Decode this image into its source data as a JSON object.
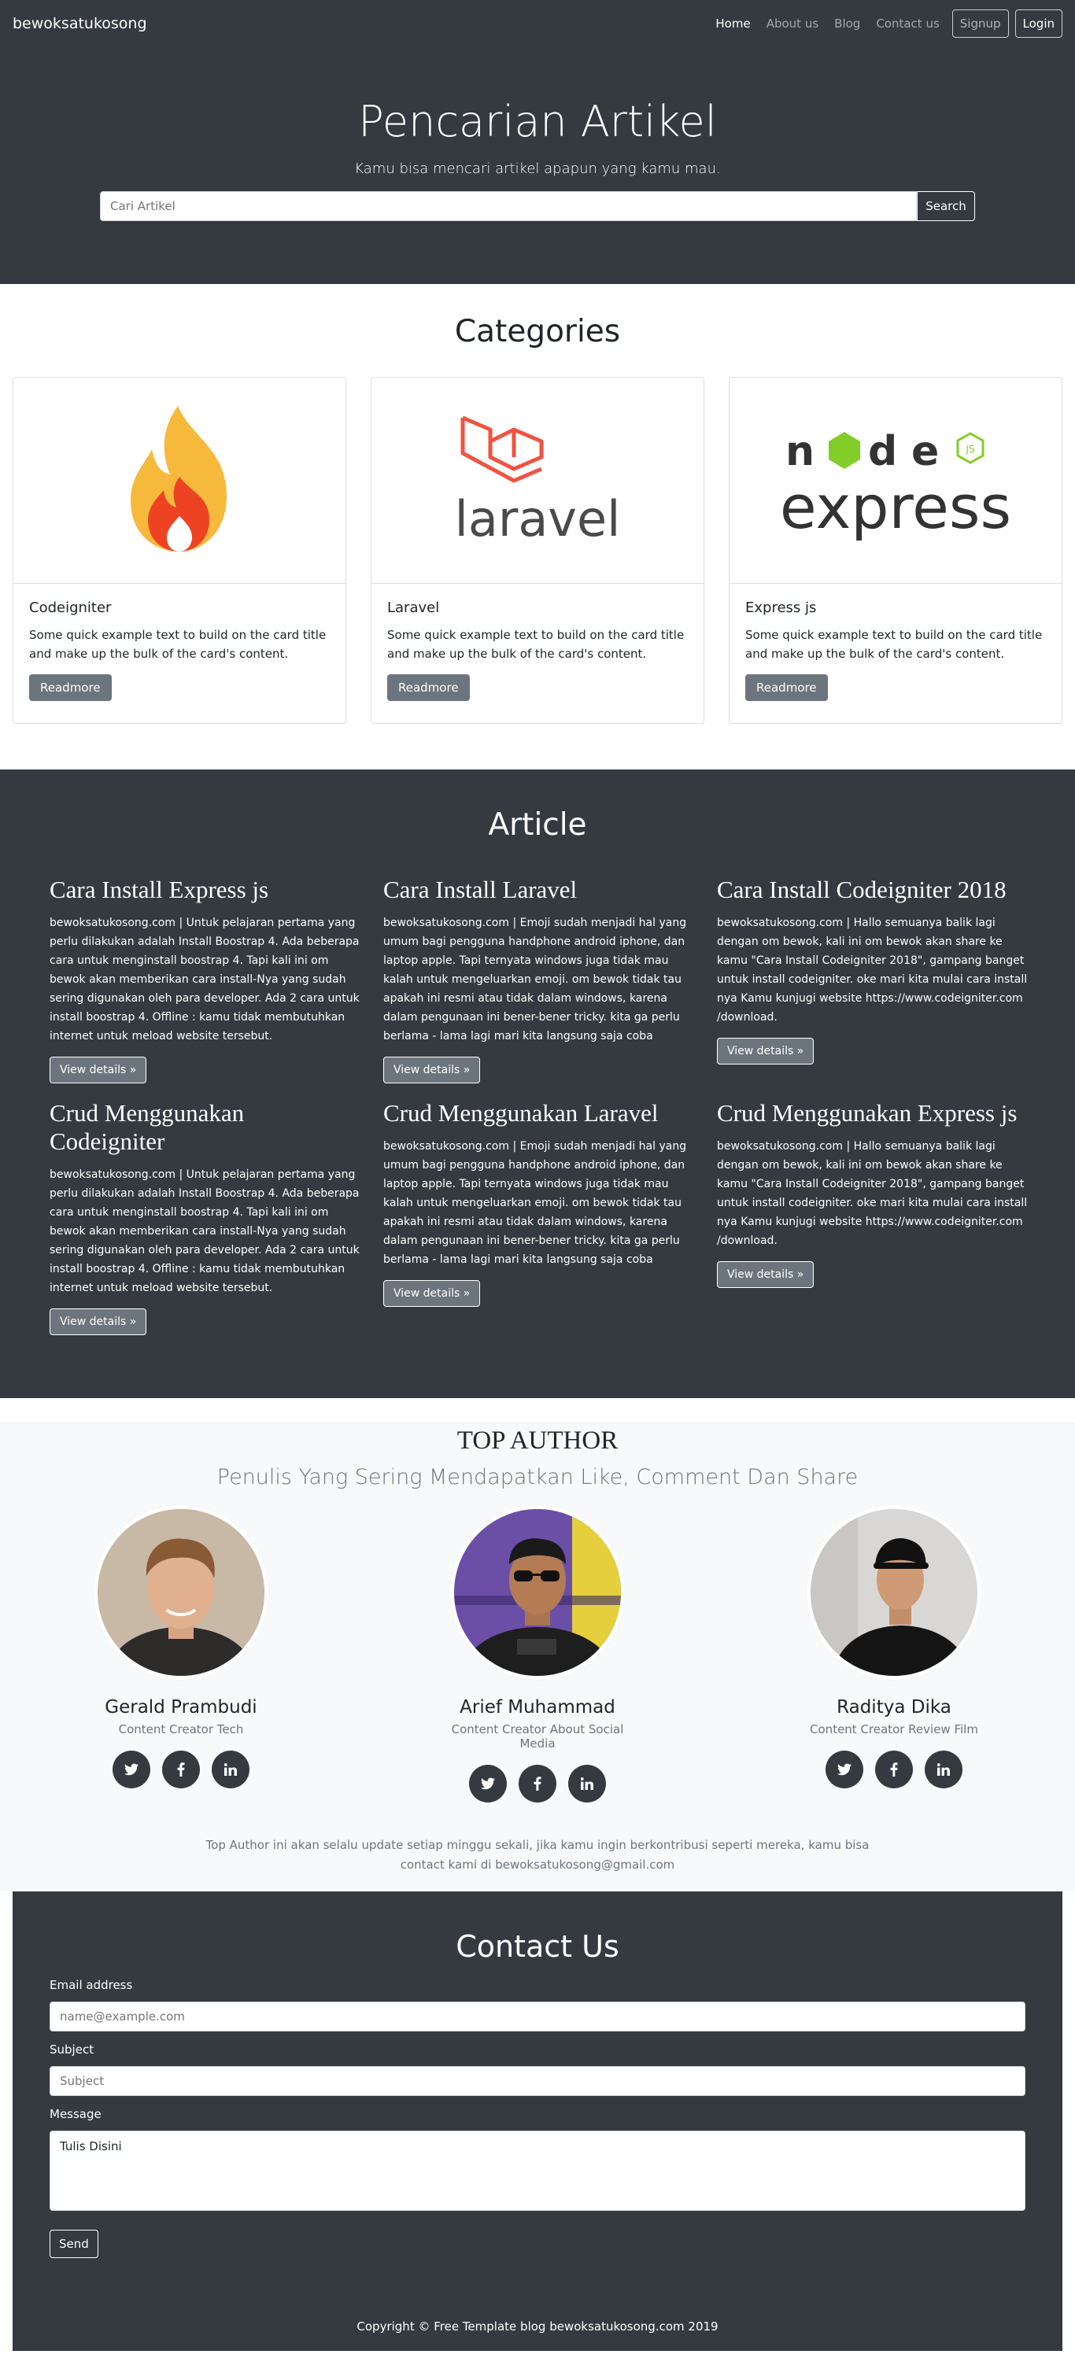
{
  "nav": {
    "brand": "bewoksatukosong",
    "links": [
      "Home",
      "About us",
      "Blog",
      "Contact us"
    ],
    "signup": "Signup",
    "login": "Login"
  },
  "hero": {
    "title": "Pencarian Artikel",
    "subtitle": "Kamu bisa mencari artikel apapun yang kamu mau.",
    "search_placeholder": "Cari Artikel",
    "search_button": "Search"
  },
  "categories": {
    "title": "Categories",
    "cards": [
      {
        "title": "Codeigniter",
        "text": "Some quick example text to build on the card title and make up the bulk of the card's content.",
        "button": "Readmore",
        "logo": "codeigniter-logo"
      },
      {
        "title": "Laravel",
        "text": "Some quick example text to build on the card title and make up the bulk of the card's content.",
        "button": "Readmore",
        "logo": "laravel-logo",
        "logo_text": "laravel"
      },
      {
        "title": "Express js",
        "text": "Some quick example text to build on the card title and make up the bulk of the card's content.",
        "button": "Readmore",
        "logo": "node-express-logo",
        "logo_text": "express"
      }
    ]
  },
  "articles": {
    "title": "Article",
    "items": [
      {
        "title": "Cara Install Express js",
        "text": "bewoksatukosong.com | Untuk pelajaran pertama yang perlu dilakukan adalah Install Boostrap 4. Ada beberapa cara untuk menginstall boostrap 4. Tapi kali ini om bewok akan memberikan cara install-Nya yang sudah sering digunakan oleh para developer. Ada 2 cara untuk install boostrap 4. Offline : kamu tidak membutuhkan internet untuk meload website tersebut.",
        "button": "View details »"
      },
      {
        "title": "Cara Install Laravel",
        "text": "bewoksatukosong.com | Emoji sudah menjadi hal yang umum bagi pengguna handphone android iphone, dan laptop apple. Tapi ternyata windows juga tidak mau kalah untuk mengeluarkan emoji. om bewok tidak tau apakah ini resmi atau tidak dalam windows, karena dalam pengunaan ini bener-bener tricky. kita ga perlu berlama - lama lagi mari kita langsung saja coba",
        "button": "View details »"
      },
      {
        "title": "Cara Install Codeigniter 2018",
        "text": "bewoksatukosong.com | Hallo semuanya balik lagi dengan om bewok, kali ini om bewok akan share ke kamu \"Cara Install Codeigniter 2018\", gampang banget untuk install codeigniter. oke mari kita mulai cara install nya Kamu kunjugi website https://www.codeigniter.com /download.",
        "button": "View details »"
      },
      {
        "title": "Crud Menggunakan Codeigniter",
        "text": "bewoksatukosong.com | Untuk pelajaran pertama yang perlu dilakukan adalah Install Boostrap 4. Ada beberapa cara untuk menginstall boostrap 4. Tapi kali ini om bewok akan memberikan cara install-Nya yang sudah sering digunakan oleh para developer. Ada 2 cara untuk install boostrap 4. Offline : kamu tidak membutuhkan internet untuk meload website tersebut.",
        "button": "View details »"
      },
      {
        "title": "Crud Menggunakan Laravel",
        "text": "bewoksatukosong.com | Emoji sudah menjadi hal yang umum bagi pengguna handphone android iphone, dan laptop apple. Tapi ternyata windows juga tidak mau kalah untuk mengeluarkan emoji. om bewok tidak tau apakah ini resmi atau tidak dalam windows, karena dalam pengunaan ini bener-bener tricky. kita ga perlu berlama - lama lagi mari kita langsung saja coba",
        "button": "View details »"
      },
      {
        "title": "Crud Menggunakan Express js",
        "text": "bewoksatukosong.com | Hallo semuanya balik lagi dengan om bewok, kali ini om bewok akan share ke kamu \"Cara Install Codeigniter 2018\", gampang banget untuk install codeigniter. oke mari kita mulai cara install nya Kamu kunjugi website https://www.codeigniter.com /download.",
        "button": "View details »"
      }
    ]
  },
  "authors": {
    "title": "TOP AUTHOR",
    "subtitle": "Penulis Yang Sering Mendapatkan Like, Comment Dan Share",
    "people": [
      {
        "name": "Gerald Prambudi",
        "role": "Content Creator Tech"
      },
      {
        "name": "Arief Muhammad",
        "role": "Content Creator About Social Media"
      },
      {
        "name": "Raditya Dika",
        "role": "Content Creator Review Film"
      }
    ],
    "note": "Top Author ini akan selalu update setiap minggu sekali, jika kamu ingin berkontribusi seperti mereka, kamu bisa contact kami di bewoksatukosong@gmail.com",
    "socials": [
      "twitter-icon",
      "facebook-icon",
      "linkedin-icon"
    ]
  },
  "contact": {
    "title": "Contact Us",
    "email_label": "Email address",
    "email_placeholder": "name@example.com",
    "subject_label": "Subject",
    "subject_placeholder": "Subject",
    "message_label": "Message",
    "message_value": "Tulis Disini",
    "send": "Send",
    "copyright": "Copyright © Free Template blog bewoksatukosong.com 2019"
  }
}
